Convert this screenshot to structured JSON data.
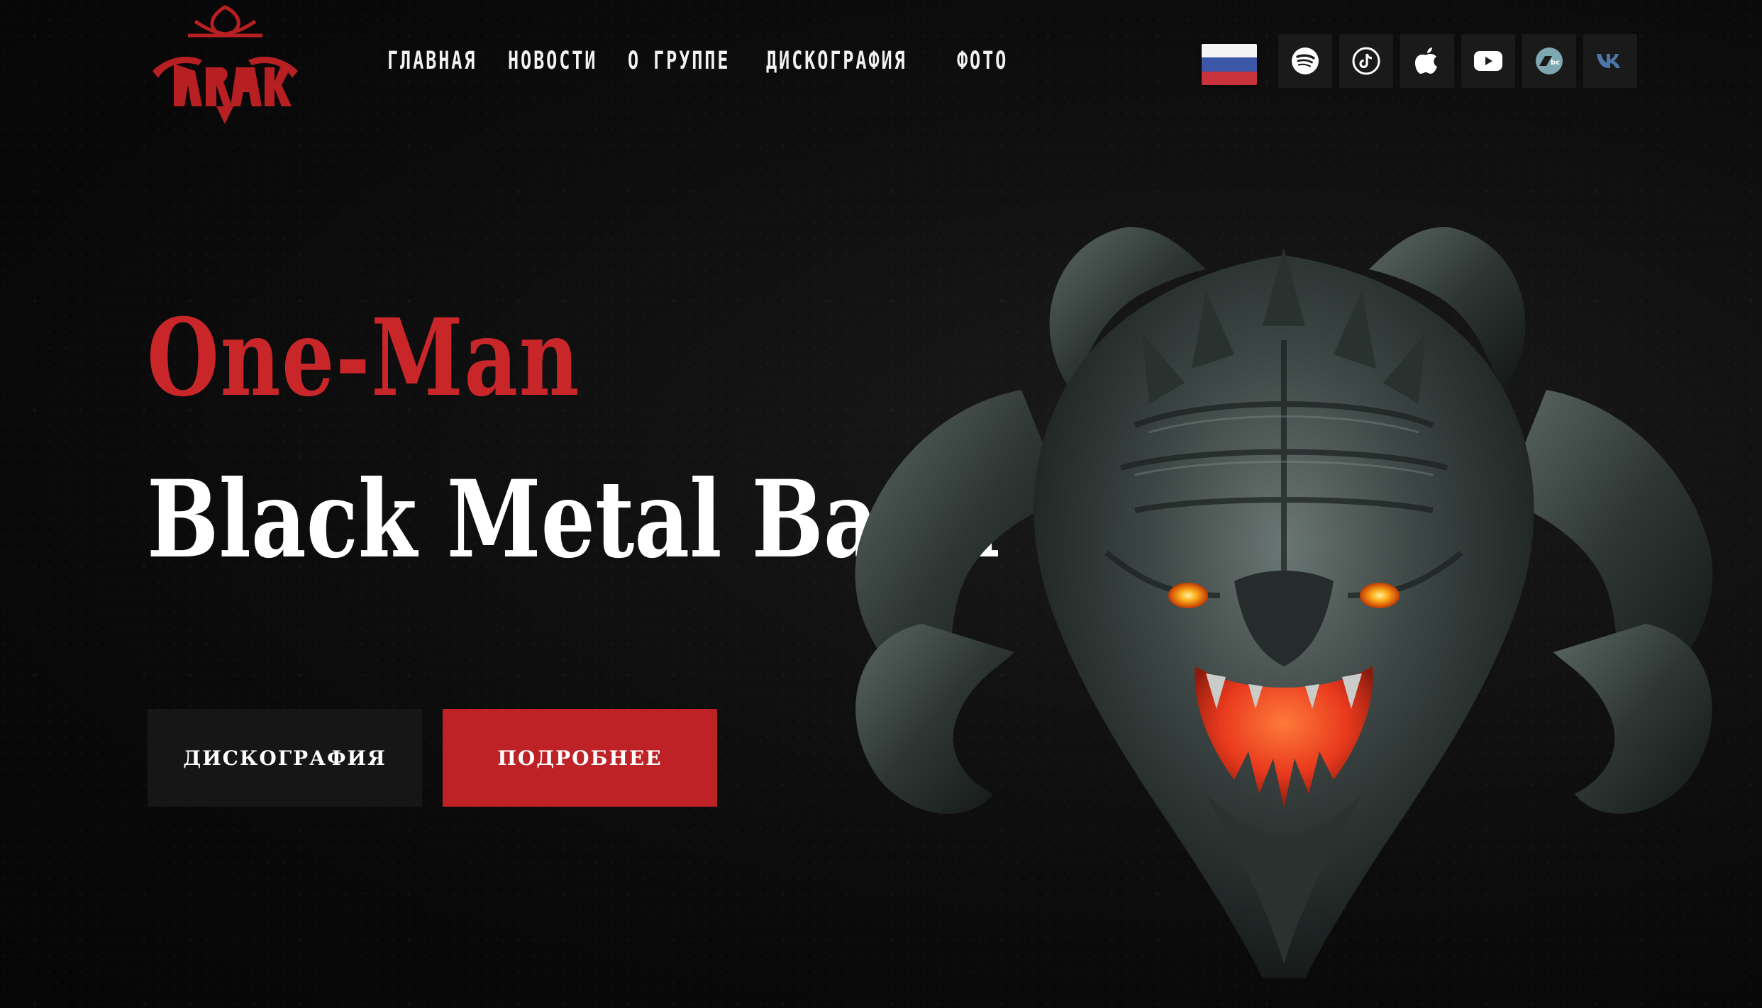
{
  "header": {
    "logo_text": "DRAKON",
    "nav": [
      {
        "label": "ГЛАВНАЯ"
      },
      {
        "label": "НОВОСТИ"
      },
      {
        "label": "О ГРУППЕ"
      },
      {
        "label": "ДИСКОГРАФИЯ"
      },
      {
        "label": "ФОТО"
      }
    ],
    "language_flag": "russia-flag-icon",
    "socials": [
      {
        "icon": "spotify-icon"
      },
      {
        "icon": "tiktok-icon"
      },
      {
        "icon": "apple-music-icon"
      },
      {
        "icon": "youtube-icon"
      },
      {
        "icon": "bandcamp-icon"
      },
      {
        "icon": "vk-icon"
      }
    ]
  },
  "hero": {
    "title_red": "One-Man",
    "title_white": "Black Metal Band",
    "buttons": {
      "discography": "ДИСКОГРАФИЯ",
      "more": "ПОДРОБНЕЕ"
    },
    "image": "demon-head-illustration"
  },
  "colors": {
    "accent_red": "#be2226",
    "title_red": "#c9262a",
    "background": "#0b0b0b",
    "button_dark": "#161616",
    "social_tile": "#1a1a1a",
    "vk_blue": "#4a76a8"
  }
}
